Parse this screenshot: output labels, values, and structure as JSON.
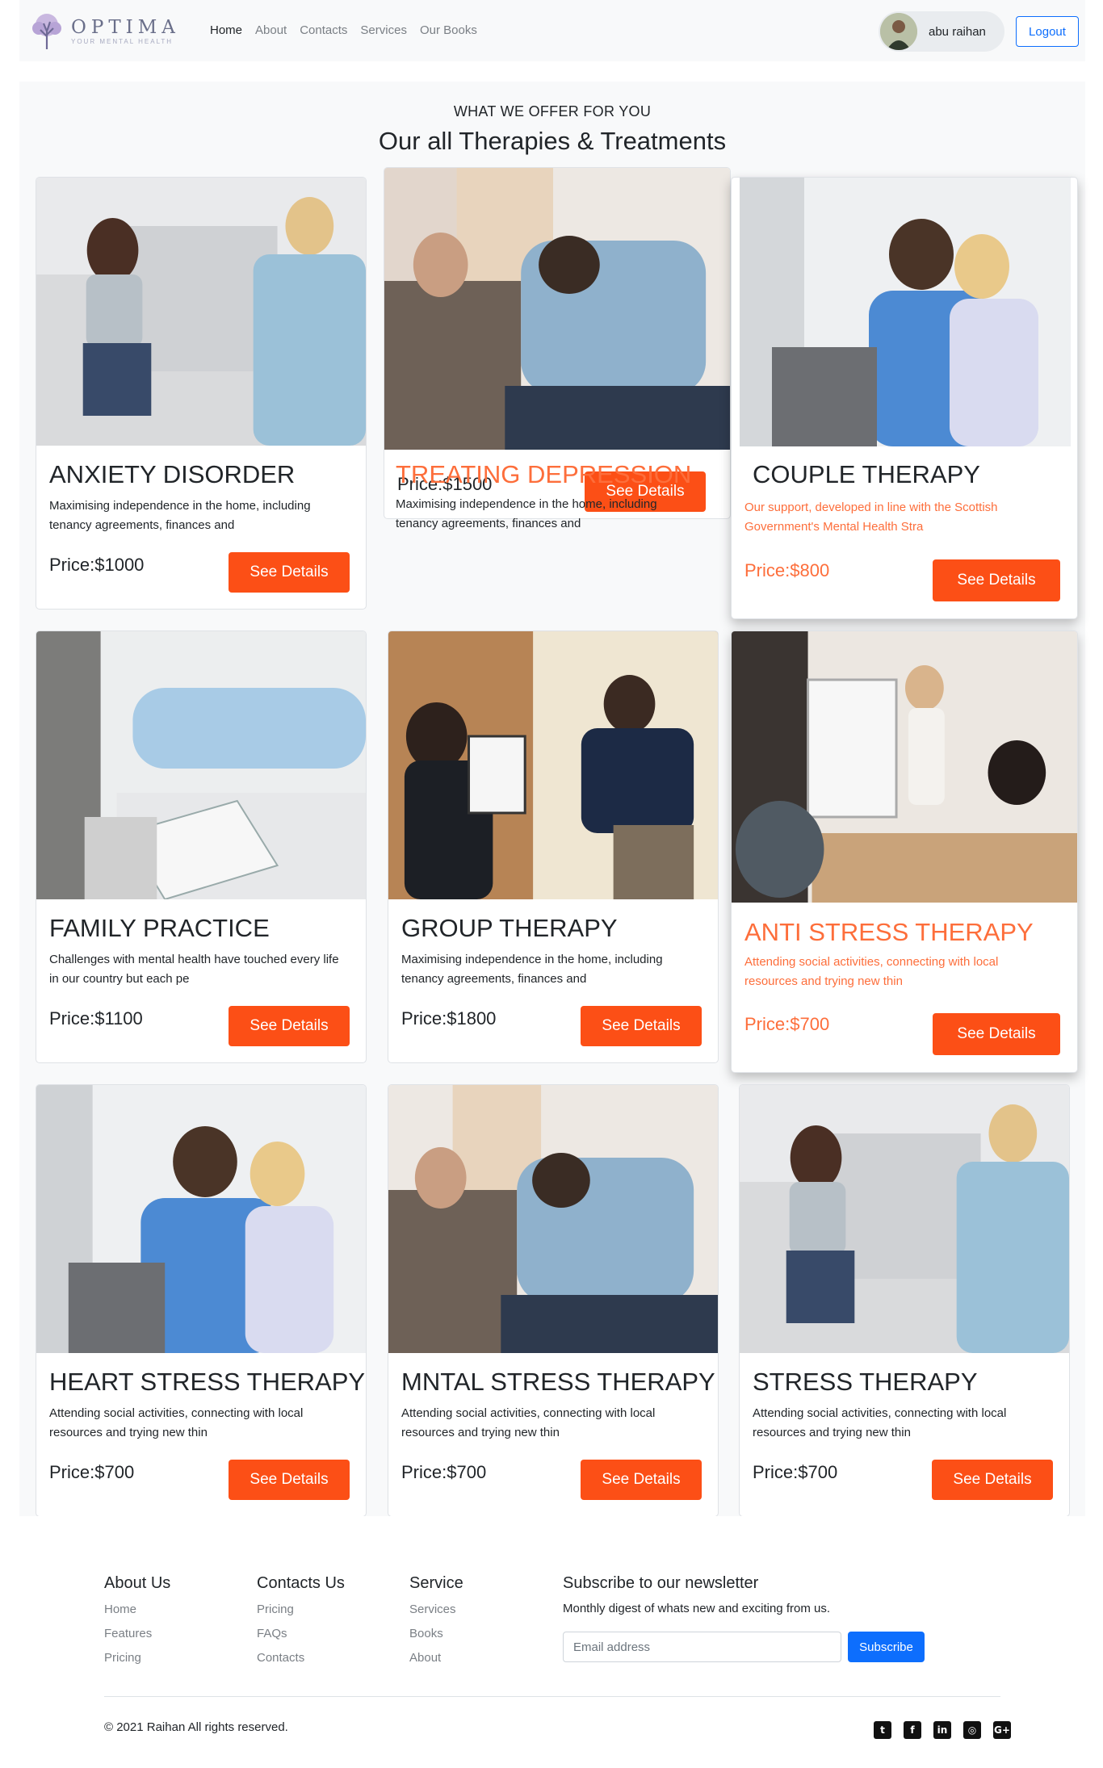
{
  "brand": {
    "name": "OPTIMA",
    "tagline": "YOUR MENTAL HEALTH"
  },
  "nav": {
    "links": [
      "Home",
      "About",
      "Contacts",
      "Services",
      "Our Books"
    ]
  },
  "user": {
    "name": "abu raihan",
    "logout_label": "Logout"
  },
  "section": {
    "subtitle": "WHAT WE OFFER FOR YOU",
    "title": "Our all Therapies & Treatments"
  },
  "cards": [
    {
      "title": "ANXIETY DISORDER",
      "desc": "Maximising independence in the home, including tenancy agreements, finances and",
      "price": "Price:$1000",
      "button": "See Details"
    },
    {
      "title": "TREATING DEPRESSION",
      "desc": "Maximising independence in the home, including tenancy agreements, finances and",
      "price": "Price:$1500",
      "button": "See Details"
    },
    {
      "title": "COUPLE THERAPY",
      "desc": "Our support, developed in line with the Scottish Government's Mental Health Stra",
      "price": "Price:$800",
      "button": "See Details"
    },
    {
      "title": "FAMILY PRACTICE",
      "desc": "Challenges with mental health have touched every life in our country but each pe",
      "price": "Price:$1100",
      "button": "See Details"
    },
    {
      "title": "GROUP THERAPY",
      "desc": "Maximising independence in the home, including tenancy agreements, finances and",
      "price": "Price:$1800",
      "button": "See Details"
    },
    {
      "title": "ANTI STRESS THERAPY",
      "desc": "Attending social activities, connecting with local resources and trying new thin",
      "price": "Price:$700",
      "button": "See Details"
    },
    {
      "title": "HEART STRESS THERAPY",
      "desc": "Attending social activities, connecting with local resources and trying new thin",
      "price": "Price:$700",
      "button": "See Details"
    },
    {
      "title": "MNTAL STRESS THERAPY",
      "desc": "Attending social activities, connecting with local resources and trying new thin",
      "price": "Price:$700",
      "button": "See Details"
    },
    {
      "title": "STRESS THERAPY",
      "desc": "Attending social activities, connecting with local resources and trying new thin",
      "price": "Price:$700",
      "button": "See Details"
    }
  ],
  "footer": {
    "about": {
      "title": "About Us",
      "links": [
        "Home",
        "Features",
        "Pricing"
      ]
    },
    "contacts": {
      "title": "Contacts Us",
      "links": [
        "Pricing",
        "FAQs",
        "Contacts"
      ]
    },
    "service": {
      "title": "Service",
      "links": [
        "Services",
        "Books",
        "About"
      ]
    },
    "newsletter": {
      "title": "Subscribe to our newsletter",
      "desc": "Monthly digest of whats new and exciting from us.",
      "placeholder": "Email address",
      "button": "Subscribe"
    },
    "copyright": "© 2021 Raihan All rights reserved.",
    "social_icons": [
      "twitter-icon",
      "facebook-icon",
      "linkedin-icon",
      "instagram-icon",
      "google-plus-icon"
    ]
  },
  "colors": {
    "accent": "#fc4f16",
    "hover_text": "#fd6e3b",
    "primary": "#0d6efd",
    "section_bg": "#f8f9fa"
  }
}
